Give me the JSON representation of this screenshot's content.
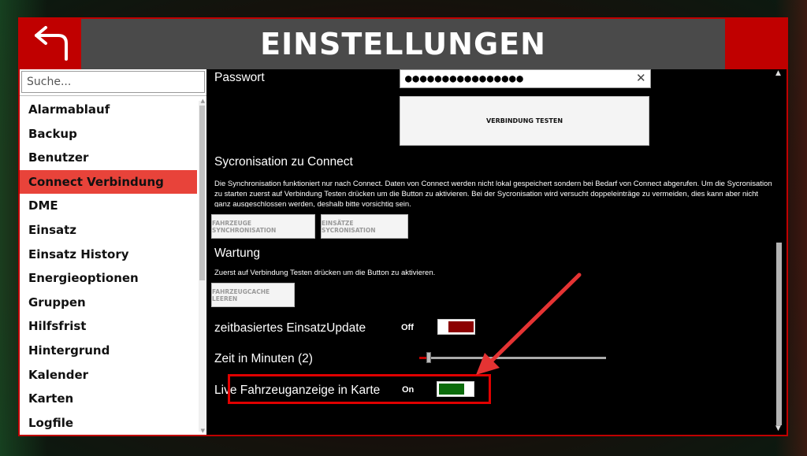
{
  "header": {
    "title": "EINSTELLUNGEN",
    "back_icon": "back-arrow-icon"
  },
  "sidebar": {
    "search_placeholder": "Suche...",
    "items": [
      {
        "label": "Alarmablauf",
        "active": false
      },
      {
        "label": "Backup",
        "active": false
      },
      {
        "label": "Benutzer",
        "active": false
      },
      {
        "label": "Connect Verbindung",
        "active": true
      },
      {
        "label": "DME",
        "active": false
      },
      {
        "label": "Einsatz",
        "active": false
      },
      {
        "label": "Einsatz History",
        "active": false
      },
      {
        "label": "Energieoptionen",
        "active": false
      },
      {
        "label": "Gruppen",
        "active": false
      },
      {
        "label": "Hilfsfrist",
        "active": false
      },
      {
        "label": "Hintergrund",
        "active": false
      },
      {
        "label": "Kalender",
        "active": false
      },
      {
        "label": "Karten",
        "active": false
      },
      {
        "label": "Logfile",
        "active": false
      }
    ]
  },
  "content": {
    "password_label": "Passwort",
    "password_value": "●●●●●●●●●●●●●●●●",
    "test_button": "VERBINDUNG TESTEN",
    "sync_heading": "Sycronisation zu Connect",
    "sync_desc": "Die Synchronisation funktioniert nur nach Connect. Daten von Connect werden nicht lokal gespeichert sondern bei Bedarf von Connect abgerufen. Um die Sycronisation zu starten zuerst auf Verbindung Testen drücken um die Button zu aktivieren. Bei der Sycronisation wird versucht doppeleinträge zu vermeiden, dies kann aber nicht ganz ausgeschlossen werden, deshalb bitte vorsichtig sein.",
    "sync_vehicles_button": "FAHRZEUGE SYNCHRONISATION",
    "sync_missions_button": "EINSÄTZE SYCRONISATION",
    "maintenance_heading": "Wartung",
    "maintenance_desc": "Zuerst auf Verbindung Testen drücken um die Button zu aktivieren.",
    "clear_cache_button": "FAHRZEUGCACHE LEEREN",
    "time_update_label": "zeitbasiertes EinsatzUpdate",
    "time_update_state": "Off",
    "time_minutes_label": "Zeit in Minuten (2)",
    "time_minutes_value": 2,
    "live_label": "Live Fahrzeuganzeige in Karte",
    "live_state": "On"
  },
  "colors": {
    "accent_red": "#c00000",
    "active_item": "#e8433a",
    "toggle_off": "#8b0000",
    "toggle_on": "#0b6b0b",
    "header_gray": "#4a4a4a"
  }
}
